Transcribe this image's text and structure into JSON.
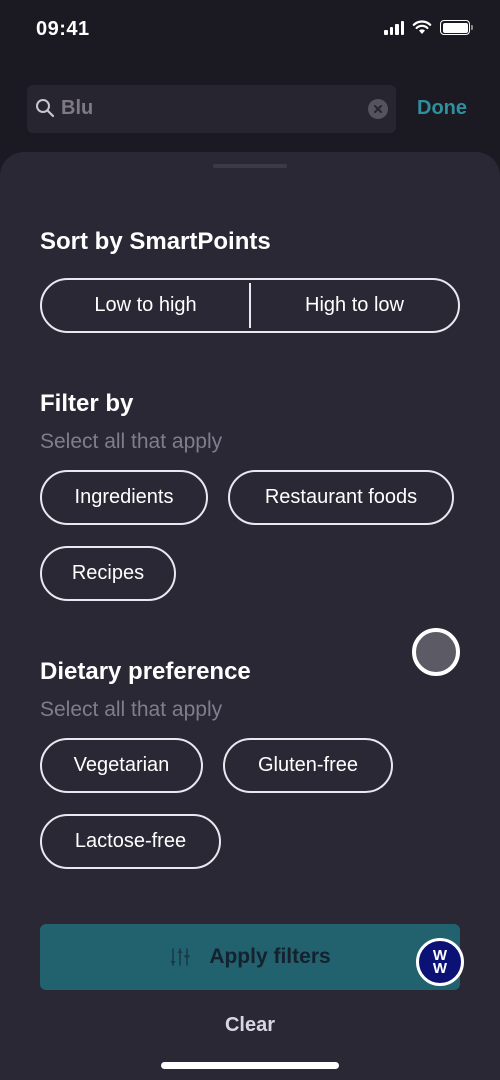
{
  "status_bar": {
    "time": "09:41",
    "icons": [
      "cellular-signal-icon",
      "wifi-icon",
      "battery-icon"
    ]
  },
  "search": {
    "value": "Blu",
    "icon": "search-icon",
    "clear_icon": "clear-icon",
    "done_label": "Done"
  },
  "sort": {
    "title": "Sort by SmartPoints",
    "options": [
      {
        "label": "Low to high"
      },
      {
        "label": "High to low"
      }
    ]
  },
  "filter": {
    "title": "Filter by",
    "subtitle": "Select all that apply",
    "chips": [
      {
        "label": "Ingredients"
      },
      {
        "label": "Restaurant foods"
      },
      {
        "label": "Recipes"
      }
    ]
  },
  "dietary": {
    "title": "Dietary preference",
    "subtitle": "Select all that apply",
    "chips": [
      {
        "label": "Vegetarian"
      },
      {
        "label": "Gluten-free"
      },
      {
        "label": "Lactose-free"
      }
    ]
  },
  "actions": {
    "apply_label": "Apply filters",
    "apply_icon": "sliders-icon",
    "clear_label": "Clear"
  },
  "badge": {
    "text_top": "W",
    "text_bottom": "W"
  },
  "colors": {
    "background": "#1b1a23",
    "sheet": "#2a2835",
    "accent": "#2f8f9c",
    "apply_button": "#22626e",
    "badge": "#0c1175"
  }
}
